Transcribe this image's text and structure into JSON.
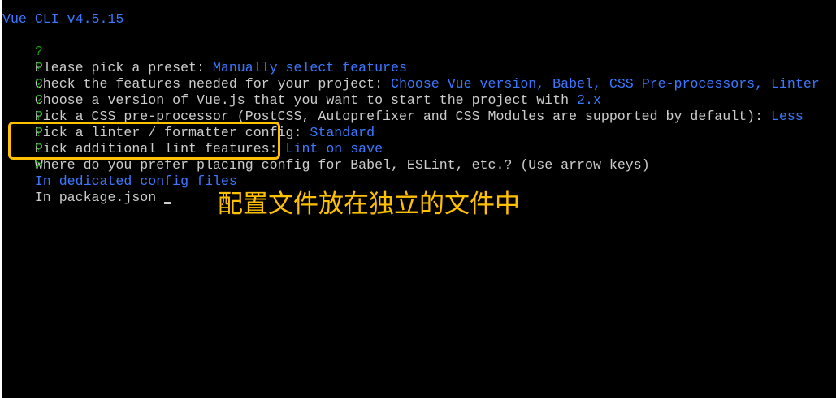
{
  "terminal": {
    "version_line": "Vue CLI v4.5.15",
    "prompt_marker": "?",
    "selector_marker": ">",
    "answered": [
      {
        "question": "Please pick a preset: ",
        "answer": "Manually select features"
      },
      {
        "question": "Check the features needed for your project: ",
        "answer": "Choose Vue version, Babel, CSS Pre-processors, Linter"
      },
      {
        "question": "Choose a version of Vue.js that you want to start the project with ",
        "answer": "2.x"
      },
      {
        "question": "Pick a CSS pre-processor (PostCSS, Autoprefixer and CSS Modules are supported by default): ",
        "answer": "Less"
      },
      {
        "question": "Pick a linter / formatter config: ",
        "answer": "Standard"
      },
      {
        "question": "Pick additional lint features: ",
        "answer": "Lint on save"
      }
    ],
    "current_question": "Where do you prefer placing config for Babel, ESLint, etc.? ",
    "current_hint": "(Use arrow keys)",
    "options": [
      {
        "label": "In dedicated config files",
        "selected": true
      },
      {
        "label": "In package.json",
        "selected": false
      }
    ]
  },
  "annotation": {
    "text": "配置文件放在独立的文件中",
    "color": "#ffc000"
  },
  "colors": {
    "background": "#000000",
    "prompt_green": "#13a10e",
    "answer_blue": "#3b78ff",
    "text": "#cccccc",
    "highlight": "#ffc000"
  }
}
